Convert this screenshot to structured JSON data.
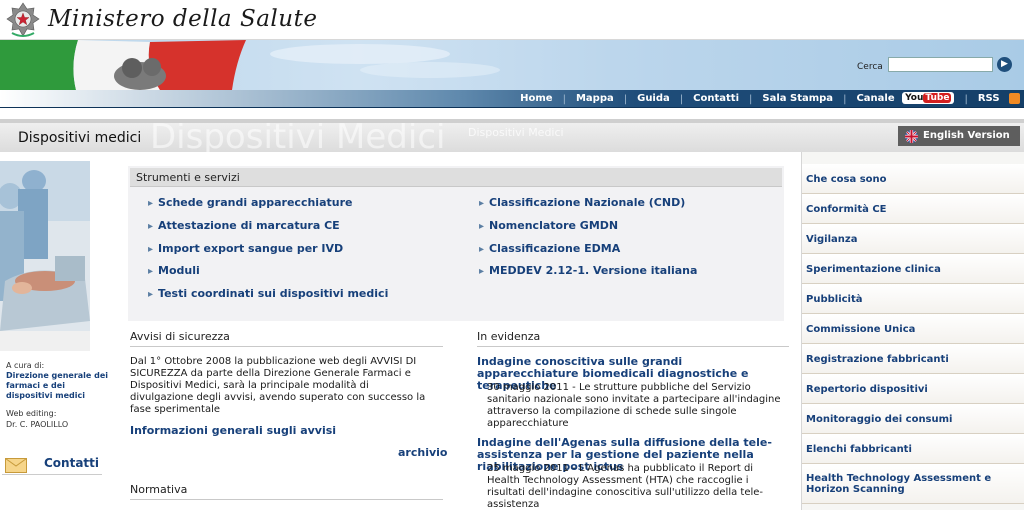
{
  "header": {
    "ministry_title": "Ministero della Salute"
  },
  "search": {
    "label": "Cerca",
    "placeholder": "",
    "value": ""
  },
  "nav": {
    "items": [
      "Home",
      "Mappa",
      "Guida",
      "Contatti",
      "Sala Stampa",
      "Canale"
    ],
    "youtube_you": "You",
    "youtube_tube": "Tube",
    "rss": "RSS"
  },
  "section": {
    "title": "Dispositivi medici",
    "watermark": "Dispositivi Medici",
    "watermark_small": "Dispositivi Medici",
    "english_version": "English Version"
  },
  "left": {
    "curated_label": "A cura di:",
    "curated_dept": "Direzione generale dei farmaci e dei dispositivi medici",
    "web_editing_label": "Web editing:",
    "web_editing_name": "Dr. C. PAOLILLO",
    "contact_label": "Contatti"
  },
  "tools": {
    "header": "Strumenti e servizi",
    "left_links": [
      "Schede grandi apparecchiature",
      "Attestazione di marcatura CE",
      "Import export sangue per IVD",
      "Moduli",
      "Testi coordinati sui dispositivi medici"
    ],
    "right_links": [
      "Classificazione Nazionale (CND)",
      "Nomenclatore GMDN",
      "Classificazione EDMA",
      "MEDDEV 2.12-1. Versione italiana"
    ]
  },
  "avvisi": {
    "heading": "Avvisi di sicurezza",
    "text": "Dal 1° Ottobre 2008 la pubblicazione web degli AVVISI DI SICUREZZA da parte della Direzione Generale Farmaci e Dispositivi Medici, sarà la principale modalità di divulgazione degli avvisi, avendo superato con successo la fase sperimentale",
    "info_link": "Informazioni generali sugli avvisi",
    "archive_link": "archivio",
    "normativa_heading": "Normativa"
  },
  "evidenza": {
    "heading": "In evidenza",
    "items": [
      {
        "title": "Indagine conoscitiva sulle grandi apparecchiature biomedicali diagnostiche e terapeutiche",
        "text": "30 maggio 2011 - Le strutture pubbliche del Servizio sanitario nazionale sono invitate a partecipare all'indagine attraverso la compilazione di schede sulle singole apparecchiature"
      },
      {
        "title": "Indagine dell'Agenas sulla diffusione della tele-assistenza per la gestione del paziente nella riabilitazione post ictus",
        "text": "25 maggio 2011 - L'Agenas ha pubblicato il Report di Health Technology Assessment (HTA) che raccoglie i risultati dell'indagine conoscitiva sull'utilizzo della tele-assistenza"
      }
    ]
  },
  "sidebar": {
    "items": [
      "Che cosa sono",
      "Conformità CE",
      "Vigilanza",
      "Sperimentazione clinica",
      "Pubblicità",
      "Commissione Unica",
      "Registrazione fabbricanti",
      "Repertorio dispositivi",
      "Monitoraggio dei consumi",
      "Elenchi fabbricanti",
      "Health Technology Assessment e Horizon Scanning"
    ]
  },
  "colors": {
    "link_blue": "#17407a",
    "nav_blue": "#143f68",
    "flag_green": "#2f9a3c",
    "flag_red": "#d6322c"
  },
  "icons": [
    "emblem-icon",
    "search-go-icon",
    "youtube-icon",
    "rss-icon",
    "uk-flag-icon",
    "mail-icon",
    "arrow-bullet-icon"
  ]
}
